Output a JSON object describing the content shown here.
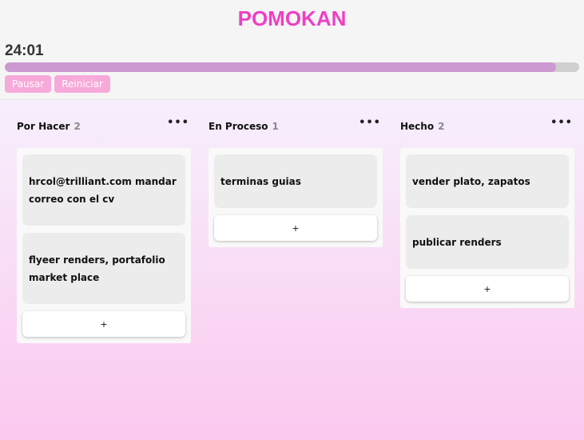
{
  "app": {
    "title": "POMOKAN"
  },
  "timer": {
    "time": "24:01",
    "progress": 0.96,
    "pause_label": "Pausar",
    "restart_label": "Reiniciar"
  },
  "columns": [
    {
      "title": "Por Hacer",
      "count": "2",
      "menu": "•••",
      "cards": [
        "hrcol@trilliant.com mandar correo con el cv",
        "flyeer renders, portafolio market place"
      ],
      "add_label": "+"
    },
    {
      "title": "En Proceso",
      "count": "1",
      "menu": "•••",
      "cards": [
        "terminas guias"
      ],
      "add_label": "+"
    },
    {
      "title": "Hecho",
      "count": "2",
      "menu": "•••",
      "cards": [
        "vender plato, zapatos",
        "publicar renders"
      ],
      "add_label": "+"
    }
  ]
}
